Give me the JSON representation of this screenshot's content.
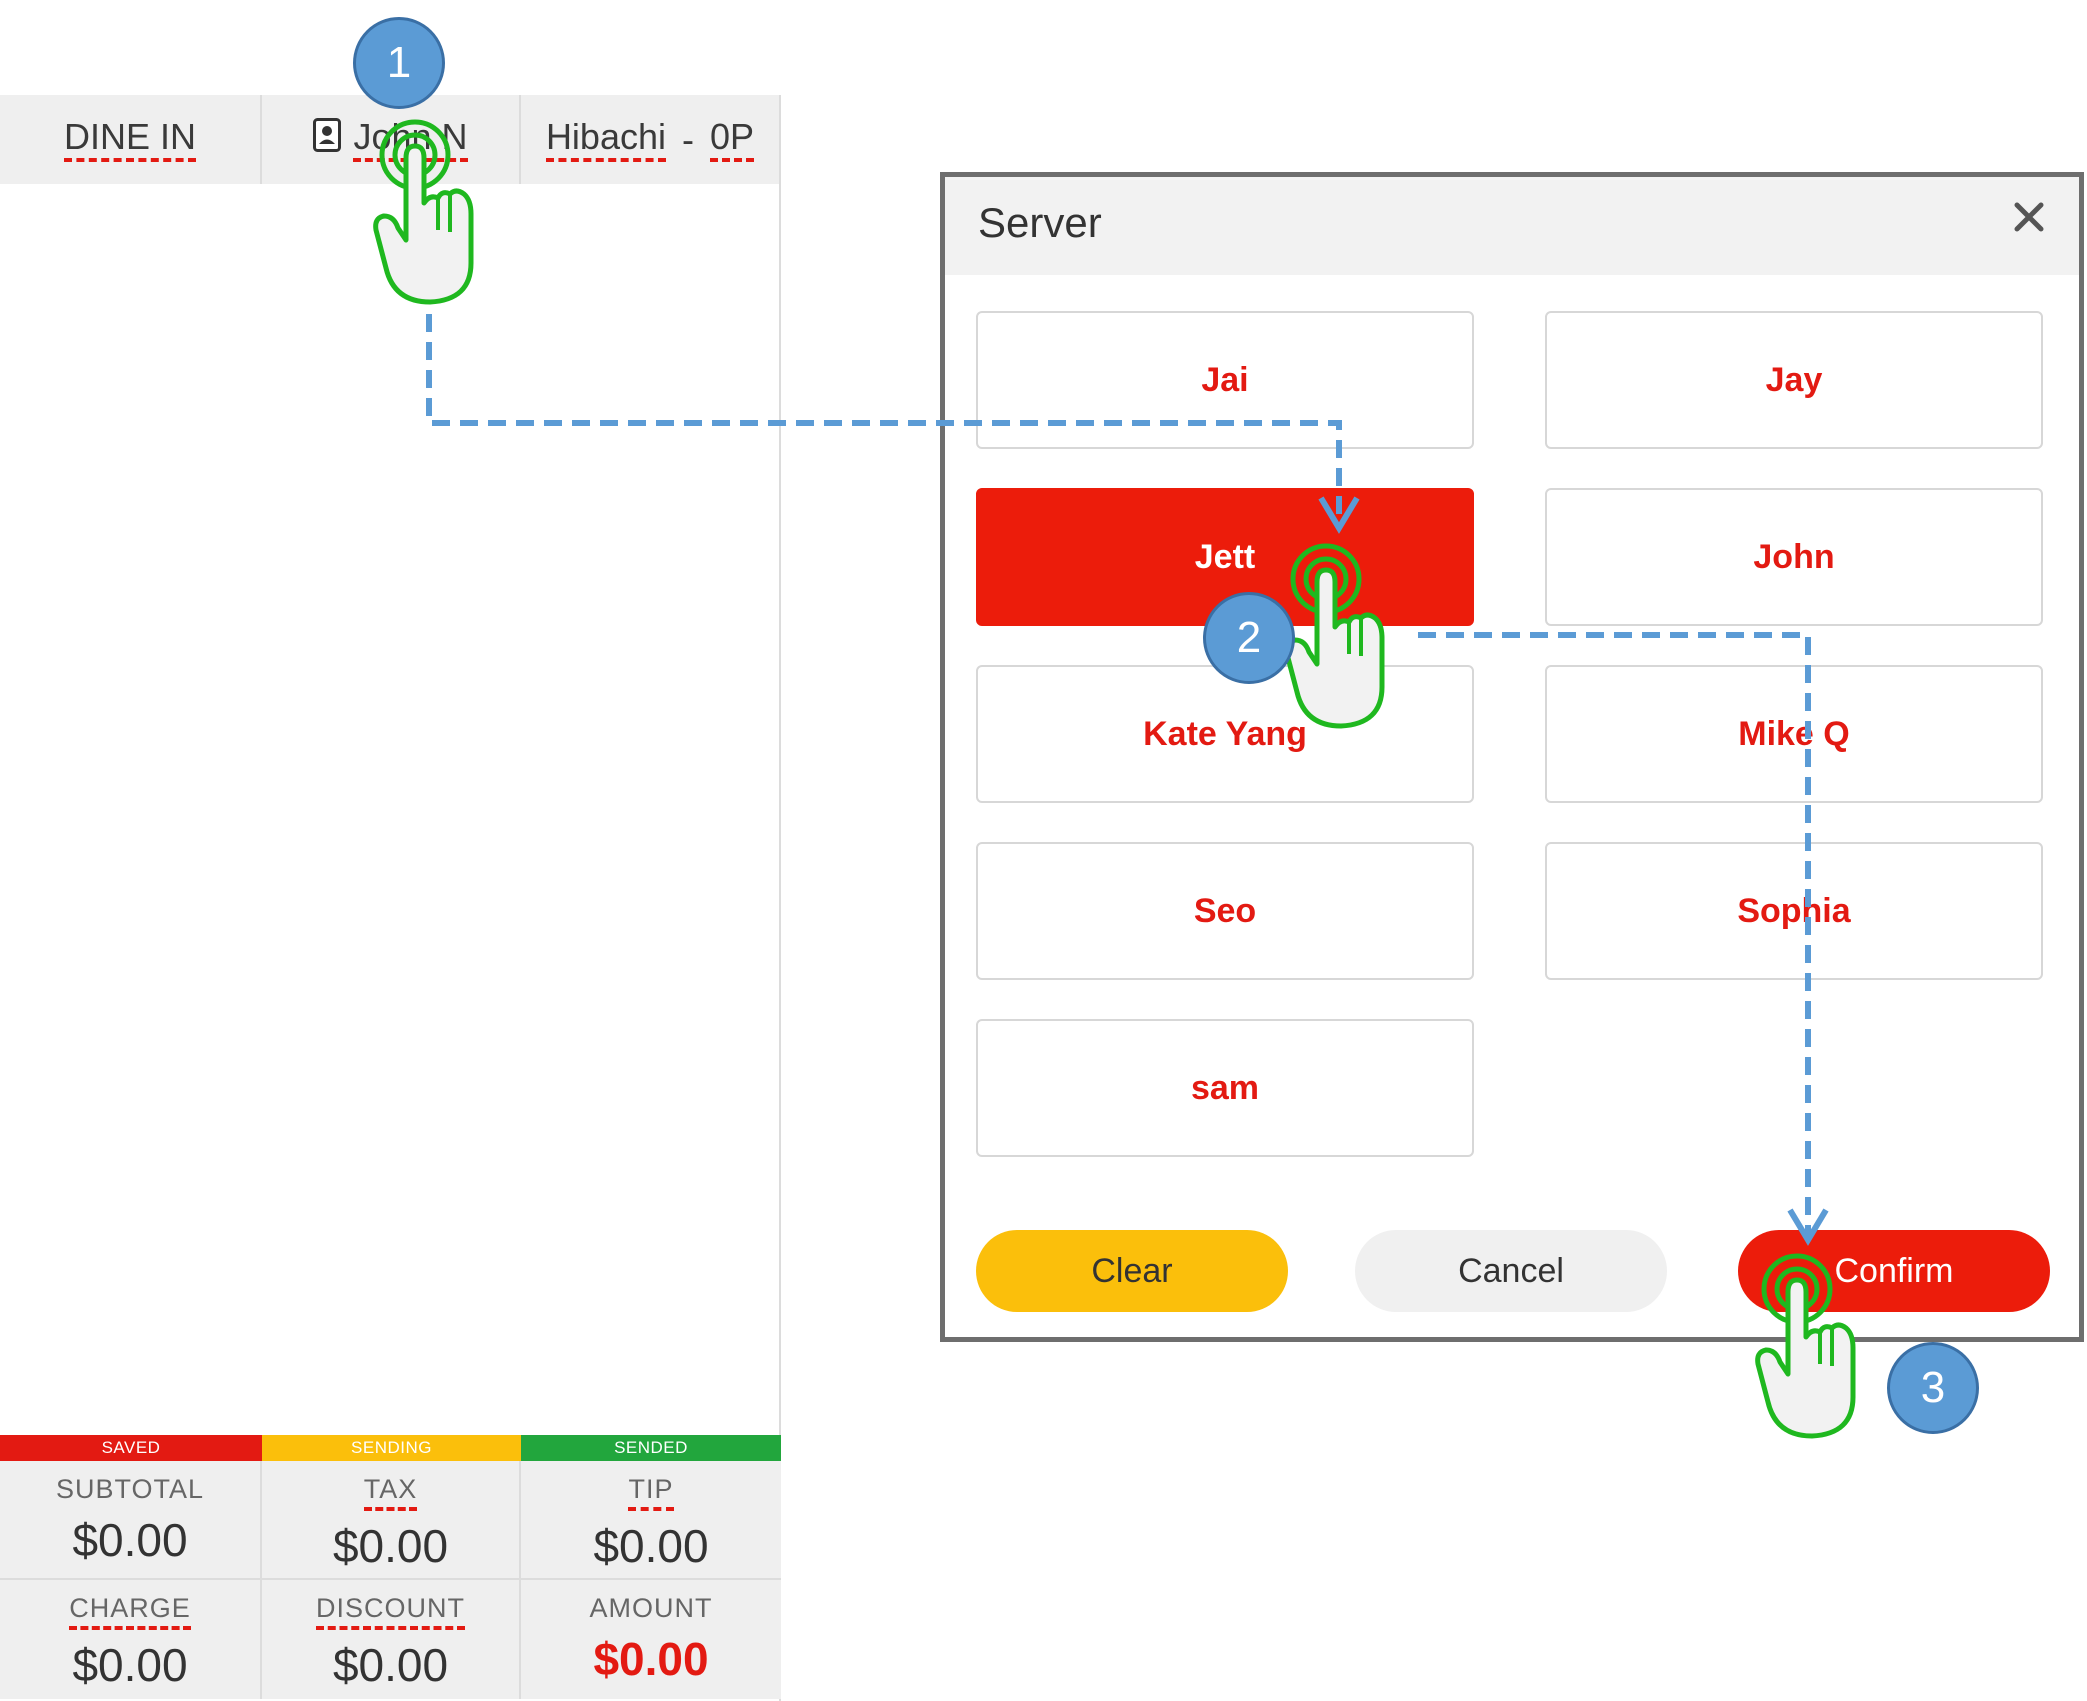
{
  "order_header": {
    "order_type": "DINE IN",
    "server_name": "John N",
    "table": "Hibachi",
    "table_separator": "-",
    "guests": "0P"
  },
  "status_bar": [
    {
      "label": "SAVED",
      "color": "#e31a12"
    },
    {
      "label": "SENDING",
      "color": "#fbbf0b"
    },
    {
      "label": "SENDED",
      "color": "#22a63d"
    }
  ],
  "totals": {
    "subtotal": {
      "label": "SUBTOTAL",
      "value": "$0.00"
    },
    "tax": {
      "label": "TAX",
      "value": "$0.00"
    },
    "tip": {
      "label": "TIP",
      "value": "$0.00"
    },
    "charge": {
      "label": "CHARGE",
      "value": "$0.00"
    },
    "discount": {
      "label": "DISCOUNT",
      "value": "$0.00"
    },
    "amount": {
      "label": "AMOUNT",
      "value": "$0.00"
    }
  },
  "server_dialog": {
    "title": "Server",
    "servers": [
      "Jai",
      "Jay",
      "Jett",
      "John",
      "Kate Yang",
      "Mike Q",
      "Seo",
      "Sophia",
      "sam"
    ],
    "selected": "Jett",
    "clear_label": "Clear",
    "cancel_label": "Cancel",
    "confirm_label": "Confirm"
  },
  "annotations": {
    "steps": [
      "1",
      "2",
      "3"
    ]
  },
  "colors": {
    "accent_red": "#e31a12",
    "clear_yellow": "#fbbf0b",
    "step_blue": "#5b9bd5",
    "tap_green": "#1fb81f"
  }
}
